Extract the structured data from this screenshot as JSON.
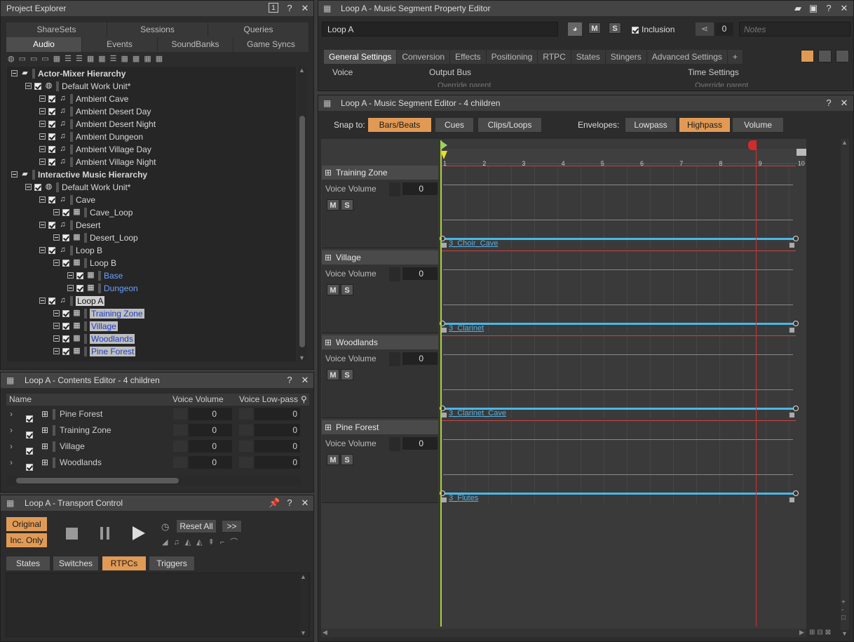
{
  "project_explorer": {
    "title": "Project Explorer",
    "header_badge": "1",
    "tabs_top": [
      "ShareSets",
      "Sessions",
      "Queries"
    ],
    "tabs_bottom": [
      "Audio",
      "Events",
      "SoundBanks",
      "Game Syncs"
    ],
    "tree": [
      {
        "label": "Actor-Mixer Hierarchy",
        "depth": 0,
        "bold": true
      },
      {
        "label": "Default Work Unit*",
        "depth": 1
      },
      {
        "label": "Ambient Cave",
        "depth": 2
      },
      {
        "label": "Ambient Desert Day",
        "depth": 2
      },
      {
        "label": "Ambient Desert Night",
        "depth": 2
      },
      {
        "label": "Ambient Dungeon",
        "depth": 2
      },
      {
        "label": "Ambient Village Day",
        "depth": 2
      },
      {
        "label": "Ambient Village Night",
        "depth": 2
      },
      {
        "label": "Interactive Music Hierarchy",
        "depth": 0,
        "bold": true
      },
      {
        "label": "Default Work Unit*",
        "depth": 1
      },
      {
        "label": "Cave",
        "depth": 2
      },
      {
        "label": "Cave_Loop",
        "depth": 3
      },
      {
        "label": "Desert",
        "depth": 2
      },
      {
        "label": "Desert_Loop",
        "depth": 3
      },
      {
        "label": "Loop B",
        "depth": 2
      },
      {
        "label": "Loop B",
        "depth": 3
      },
      {
        "label": "Base",
        "depth": 4,
        "blue": true
      },
      {
        "label": "Dungeon",
        "depth": 4,
        "blue": true
      },
      {
        "label": "Loop A",
        "depth": 2,
        "selected": true
      },
      {
        "label": "Training Zone",
        "depth": 3,
        "sel2": true
      },
      {
        "label": "Village",
        "depth": 3,
        "sel2": true
      },
      {
        "label": "Woodlands",
        "depth": 3,
        "sel2": true
      },
      {
        "label": "Pine Forest",
        "depth": 3,
        "sel2": true
      }
    ]
  },
  "contents_editor": {
    "title": "Loop A - Contents Editor - 4 children",
    "columns": [
      "Name",
      "Voice Volume",
      "Voice Low-pass"
    ],
    "rows": [
      {
        "name": "Pine Forest",
        "vol": "0",
        "lp": "0"
      },
      {
        "name": "Training Zone",
        "vol": "0",
        "lp": "0"
      },
      {
        "name": "Village",
        "vol": "0",
        "lp": "0"
      },
      {
        "name": "Woodlands",
        "vol": "0",
        "lp": "0"
      }
    ]
  },
  "transport": {
    "title": "Loop A - Transport Control",
    "original": "Original",
    "inc_only": "Inc. Only",
    "reset_all": "Reset All",
    "more": ">>",
    "tabs": [
      "States",
      "Switches",
      "RTPCs",
      "Triggers"
    ]
  },
  "property_editor": {
    "title": "Loop A - Music Segment Property Editor",
    "name": "Loop A",
    "m": "M",
    "s": "S",
    "inclusion": "Inclusion",
    "count": "0",
    "notes_placeholder": "Notes",
    "tabs": [
      "General Settings",
      "Conversion",
      "Effects",
      "Positioning",
      "RTPC",
      "States",
      "Stingers",
      "Advanced Settings",
      "+"
    ],
    "sections": [
      "Voice",
      "Output Bus",
      "Time Settings"
    ],
    "override": "Override parent"
  },
  "segment_editor": {
    "title": "Loop A - Music Segment Editor - 4 children",
    "snap_label": "Snap to:",
    "snap": [
      "Bars/Beats",
      "Cues",
      "Clips/Loops"
    ],
    "env_label": "Envelopes:",
    "envelopes": [
      "Lowpass",
      "Highpass",
      "Volume"
    ],
    "ruler": [
      "1",
      "2",
      "3",
      "4",
      "5",
      "6",
      "7",
      "8",
      "9",
      "10"
    ],
    "tracks": [
      {
        "name": "Training Zone",
        "vol_label": "Voice Volume",
        "vol": "0",
        "clip": "3_Choir_Cave",
        "m": "M",
        "s": "S"
      },
      {
        "name": "Village",
        "vol_label": "Voice Volume",
        "vol": "0",
        "clip": "3_Clarinet",
        "m": "M",
        "s": "S"
      },
      {
        "name": "Woodlands",
        "vol_label": "Voice Volume",
        "vol": "0",
        "clip": "3_Clarinet_Cave",
        "m": "M",
        "s": "S"
      },
      {
        "name": "Pine Forest",
        "vol_label": "Voice Volume",
        "vol": "0",
        "clip": "3_Flutes",
        "m": "M",
        "s": "S"
      }
    ]
  }
}
